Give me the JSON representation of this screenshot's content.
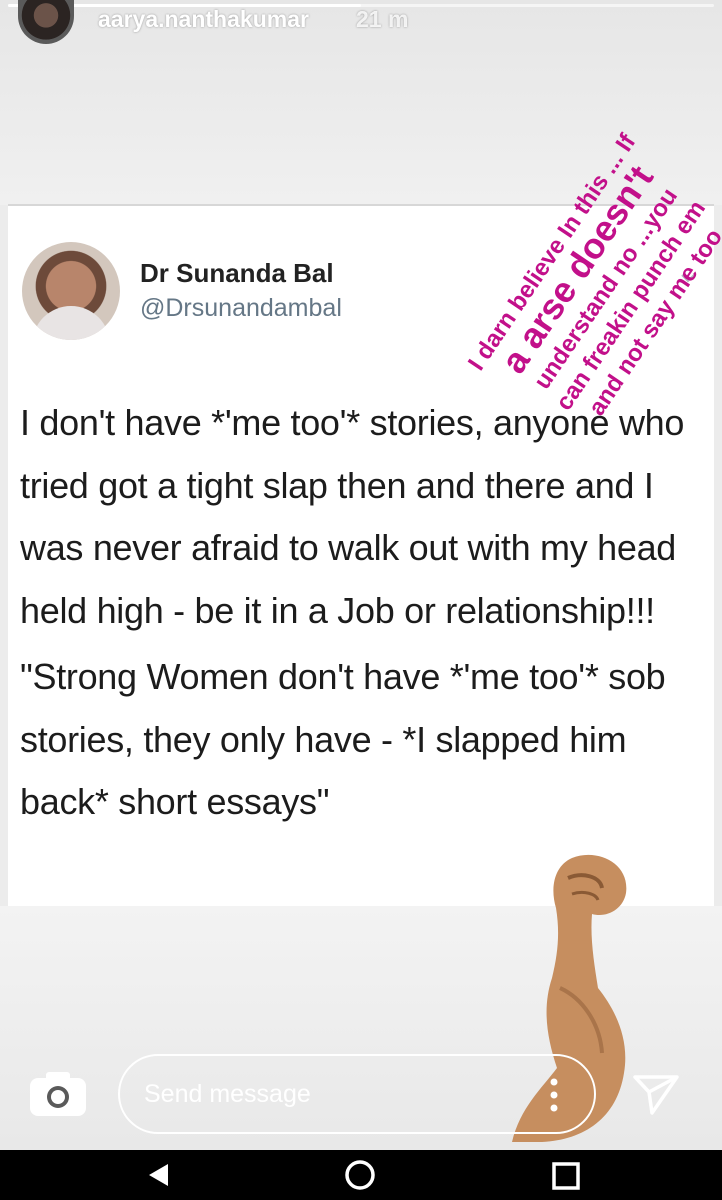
{
  "story": {
    "username": "aarya.nanthakumar",
    "time_ago": "21 m",
    "progress": 0.5
  },
  "overlay": {
    "line1": "I darn believe In this ... If",
    "line2": "a arse doesn't",
    "line3": "understand no ...you",
    "line4": "can freakin punch em",
    "line5": "and not say me too"
  },
  "tweet": {
    "author_name": "Dr Sunanda Bal",
    "author_handle": "@Drsunandambal",
    "paragraph1": "I don't have *'me too'* stories, anyone who tried got a tight slap then and there and I was never afraid to walk out with my head held high - be it in a Job or relationship!!!",
    "paragraph2": "\"Strong Women don't have *'me too'* sob stories, they only have - *I slapped him back*  short essays\""
  },
  "reply_bar": {
    "placeholder": "Send message"
  },
  "icons": {
    "camera": "camera-icon",
    "options": "more-vertical-icon",
    "send": "send-icon",
    "back": "back-icon",
    "home": "home-icon",
    "recent": "recent-apps-icon",
    "sticker": "flexed-biceps-sticker"
  },
  "colors": {
    "overlay_text": "#c2108a",
    "handle": "#657786"
  }
}
